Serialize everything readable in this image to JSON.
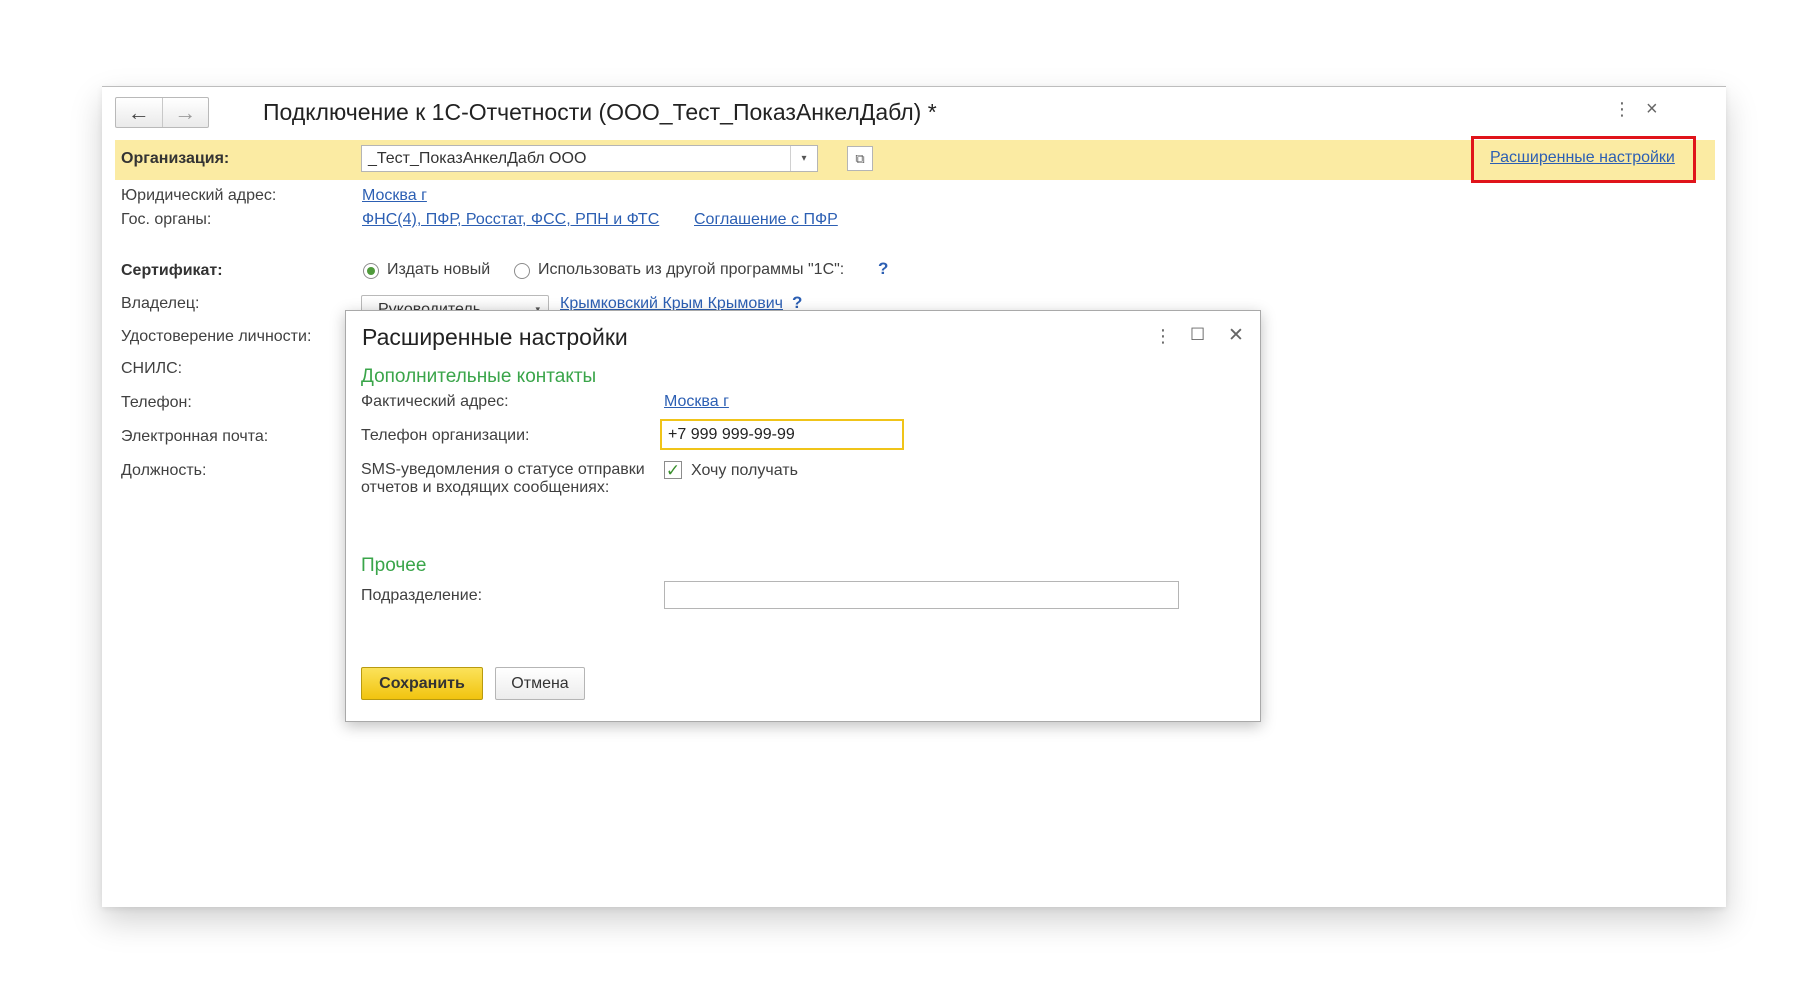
{
  "window": {
    "title": "Подключение к 1С-Отчетности (ООО_Тест_ПоказАнкелДабл) *",
    "nav": {
      "back_icon": "←",
      "forward_icon": "→"
    },
    "more_icon": "⋮",
    "close_icon": "×"
  },
  "form": {
    "org_label": "Организация:",
    "org_value": "_Тест_ПоказАнкелДабл ООО",
    "open_icon": "⧉",
    "dropdown_icon": "▾",
    "advanced_link": "Расширенные настройки",
    "legal_address_label": "Юридический адрес:",
    "legal_address_value": "Москва г",
    "gov_label": "Гос. органы:",
    "gov_value": "ФНС(4), ПФР, Росстат, ФСС, РПН и ФТС",
    "pfr_agreement": "Соглашение с ПФР",
    "certificate_label": "Сертификат:",
    "cert_option_new": "Издать новый",
    "cert_option_other": "Использовать из другой программы \"1С\":",
    "help_mark": "?",
    "owner_label": "Владелец:",
    "owner_role": "Руководитель",
    "owner_name": "Крымковский Крым Крымович",
    "id_label": "Удостоверение личности:",
    "snils_label": "СНИЛС:",
    "phone_label": "Телефон:",
    "email_label": "Электронная почта:",
    "position_label": "Должность:"
  },
  "dialog": {
    "title": "Расширенные настройки",
    "more_icon": "⋮",
    "maximize_icon": "☐",
    "close_icon": "✕",
    "section_contacts": "Дополнительные контакты",
    "actual_address_label": "Фактический адрес:",
    "actual_address_value": "Москва г",
    "org_phone_label": "Телефон организации:",
    "org_phone_value": "+7 999 999-99-99",
    "sms_label_line1": "SMS-уведомления о статусе отправки",
    "sms_label_line2": "отчетов и входящих сообщениях:",
    "sms_checkbox_label": "Хочу получать",
    "sms_checked": true,
    "section_other": "Прочее",
    "subdivision_label": "Подразделение:",
    "subdivision_value": "",
    "save_button": "Сохранить",
    "cancel_button": "Отмена"
  },
  "colors": {
    "org_bar": "#fbeba3",
    "link": "#2c5fb3",
    "section_green": "#3aa54a",
    "highlight_red": "#e0141a",
    "save_yellow": "#f1c40f"
  }
}
